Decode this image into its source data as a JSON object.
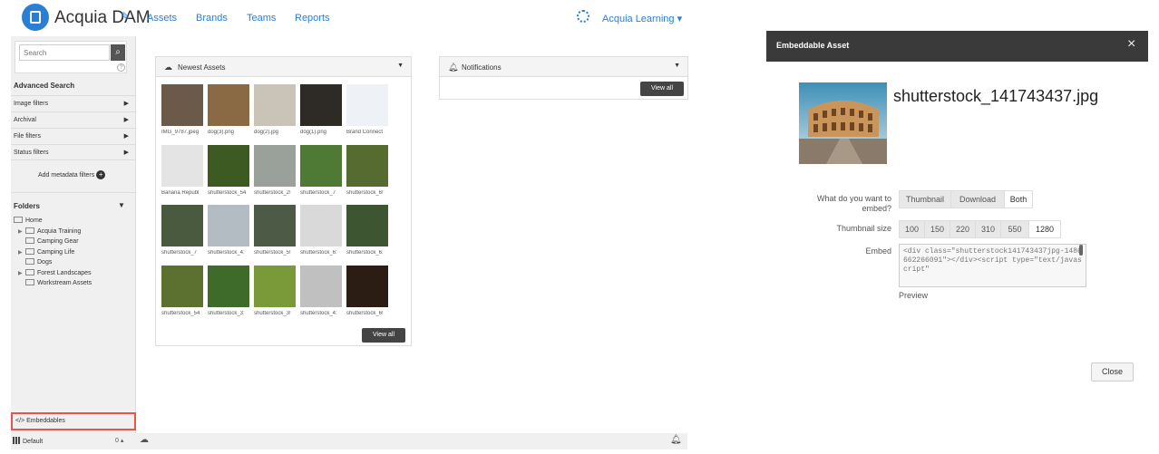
{
  "topbar": {
    "brand": "Acquia DAM",
    "nav": [
      "Assets",
      "Brands",
      "Teams",
      "Reports"
    ],
    "user_menu": "Acquia Learning"
  },
  "sidebar": {
    "search_placeholder": "Search",
    "help": "?",
    "advanced_search": "Advanced Search",
    "filters": [
      "Image filters",
      "Archival",
      "File filters",
      "Status filters"
    ],
    "add_metadata": "Add metadata filters",
    "folders_title": "Folders",
    "folders": [
      {
        "label": "Home",
        "level": 0,
        "expandable": false
      },
      {
        "label": "Acquia Training",
        "level": 1,
        "expandable": true
      },
      {
        "label": "Camping Gear",
        "level": 1,
        "expandable": false
      },
      {
        "label": "Camping Life",
        "level": 1,
        "expandable": true
      },
      {
        "label": "Dogs",
        "level": 1,
        "expandable": false
      },
      {
        "label": "Forest Landscapes",
        "level": 1,
        "expandable": true
      },
      {
        "label": "Workstream Assets",
        "level": 1,
        "expandable": false
      }
    ],
    "embeddables": "Embeddables"
  },
  "bottom_bar": {
    "default_label": "Default",
    "count": "0"
  },
  "newest_assets": {
    "title": "Newest Assets",
    "view_all": "View all",
    "items": [
      {
        "caption": "IMG_9787.jpeg",
        "color": "#6b5a4a"
      },
      {
        "caption": "dog(3).png",
        "color": "#8a6a45"
      },
      {
        "caption": "dog(2).jpg",
        "color": "#c9c3b8"
      },
      {
        "caption": "dog(1).png",
        "color": "#2e2a26"
      },
      {
        "caption": "Brand Connect",
        "color": "#eef1f6"
      },
      {
        "caption": "Banana Republ",
        "color": "#e4e4e4"
      },
      {
        "caption": "shutterstock_54",
        "color": "#3c5a22"
      },
      {
        "caption": "shutterstock_2!",
        "color": "#9aa19a"
      },
      {
        "caption": "shutterstock_7",
        "color": "#4f7a35"
      },
      {
        "caption": "shutterstock_6!",
        "color": "#556b2f"
      },
      {
        "caption": "shutterstock_7",
        "color": "#4a5a3e"
      },
      {
        "caption": "shutterstock_4:",
        "color": "#b3bcc2"
      },
      {
        "caption": "shutterstock_5!",
        "color": "#4d5a45"
      },
      {
        "caption": "shutterstock_6:",
        "color": "#d9d9d9"
      },
      {
        "caption": "shutterstock_6:",
        "color": "#3d5530"
      },
      {
        "caption": "shutterstock_54",
        "color": "#5c7030"
      },
      {
        "caption": "shutterstock_3:",
        "color": "#3f6b2a"
      },
      {
        "caption": "shutterstock_3!",
        "color": "#7a9a3a"
      },
      {
        "caption": "shutterstock_4:",
        "color": "#c0c0c0"
      },
      {
        "caption": "shutterstock_6!",
        "color": "#2b1d14"
      }
    ]
  },
  "notifications": {
    "title": "Notifications",
    "view_all": "View all"
  },
  "modal": {
    "title": "Embeddable Asset",
    "close_icon": "×",
    "file_name": "shutterstock_141743437.jpg",
    "embed_question": "What do you want to embed?",
    "embed_options": [
      "Thumbnail",
      "Download",
      "Both"
    ],
    "embed_selected": "Both",
    "size_label": "Thumbnail size",
    "sizes": [
      "100",
      "150",
      "220",
      "310",
      "550",
      "1280"
    ],
    "size_selected": "1280",
    "embed_label": "Embed",
    "embed_code": "<div class=\"shutterstock141743437jpg-1486662266091\"></div><script type=\"text/javascript\"",
    "preview_label": "Preview",
    "close_button": "Close"
  }
}
